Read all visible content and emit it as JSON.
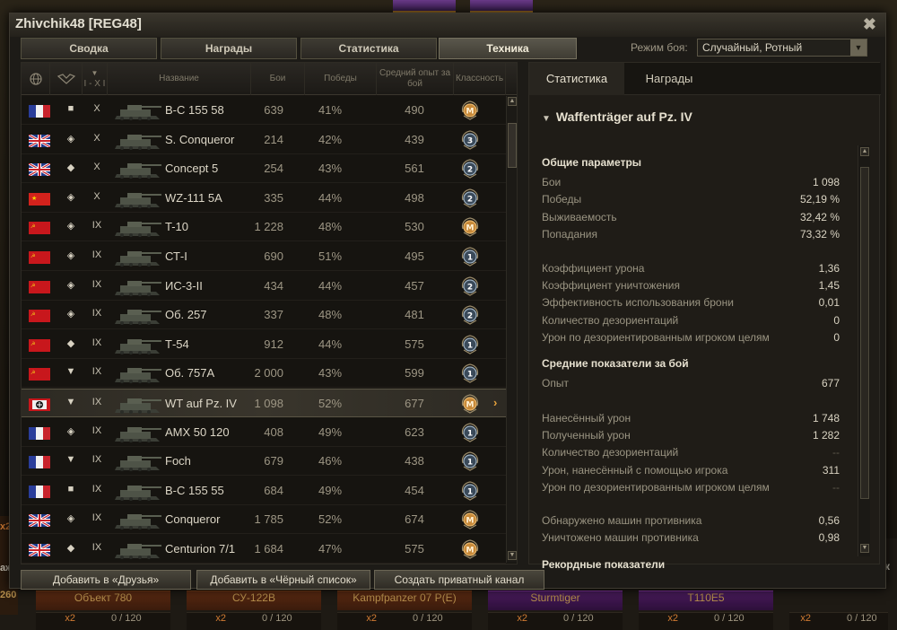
{
  "window": {
    "title": "Zhivchik48 [REG48]",
    "close_glyph": "✖"
  },
  "tabs": [
    {
      "label": "Сводка",
      "active": false
    },
    {
      "label": "Награды",
      "active": false
    },
    {
      "label": "Статистика",
      "active": false
    },
    {
      "label": "Техника",
      "active": true
    }
  ],
  "battle_mode": {
    "label": "Режим боя:",
    "value": "Случайный, Ротный",
    "arrow_glyph": "▼"
  },
  "table": {
    "columns": {
      "nation_icon": "globe-icon",
      "type_icon": "tank-type-icon",
      "tier": "I - X I",
      "name": "Название",
      "battles": "Бои",
      "wins": "Победы",
      "avg_xp": "Средний опыт за бой",
      "mastery": "Классность"
    },
    "rows": [
      {
        "nation": "france",
        "type": "spg",
        "type_glyph": "■",
        "tier": "X",
        "name": "B-C 155 58",
        "battles": "639",
        "wins": "41%",
        "xp": "490",
        "mastery": "M",
        "selected": false
      },
      {
        "nation": "uk",
        "type": "heavy",
        "type_glyph": "◈",
        "tier": "X",
        "name": "S. Conqueror",
        "battles": "214",
        "wins": "42%",
        "xp": "439",
        "mastery": "3",
        "selected": false
      },
      {
        "nation": "uk",
        "type": "medium",
        "type_glyph": "◆",
        "tier": "X",
        "name": "Concept 5",
        "battles": "254",
        "wins": "43%",
        "xp": "561",
        "mastery": "2",
        "selected": false
      },
      {
        "nation": "china",
        "type": "heavy",
        "type_glyph": "◈",
        "tier": "X",
        "name": "WZ-111 5A",
        "battles": "335",
        "wins": "44%",
        "xp": "498",
        "mastery": "2",
        "selected": false
      },
      {
        "nation": "ussr",
        "type": "heavy",
        "type_glyph": "◈",
        "tier": "IX",
        "name": "T-10",
        "battles": "1 228",
        "wins": "48%",
        "xp": "530",
        "mastery": "M",
        "selected": false
      },
      {
        "nation": "ussr",
        "type": "heavy",
        "type_glyph": "◈",
        "tier": "IX",
        "name": "СТ-I",
        "battles": "690",
        "wins": "51%",
        "xp": "495",
        "mastery": "1",
        "selected": false
      },
      {
        "nation": "ussr",
        "type": "heavy",
        "type_glyph": "◈",
        "tier": "IX",
        "name": "ИС-3-II",
        "battles": "434",
        "wins": "44%",
        "xp": "457",
        "mastery": "2",
        "selected": false
      },
      {
        "nation": "ussr",
        "type": "heavy",
        "type_glyph": "◈",
        "tier": "IX",
        "name": "Об. 257",
        "battles": "337",
        "wins": "48%",
        "xp": "481",
        "mastery": "2",
        "selected": false
      },
      {
        "nation": "ussr",
        "type": "medium",
        "type_glyph": "◆",
        "tier": "IX",
        "name": "Т-54",
        "battles": "912",
        "wins": "44%",
        "xp": "575",
        "mastery": "1",
        "selected": false
      },
      {
        "nation": "ussr",
        "type": "td",
        "type_glyph": "▼",
        "tier": "IX",
        "name": "Об. 757А",
        "battles": "2 000",
        "wins": "43%",
        "xp": "599",
        "mastery": "1",
        "selected": false
      },
      {
        "nation": "germany",
        "type": "td",
        "type_glyph": "▼",
        "tier": "IX",
        "name": "WT auf Pz. IV",
        "battles": "1 098",
        "wins": "52%",
        "xp": "677",
        "mastery": "M",
        "selected": true
      },
      {
        "nation": "france",
        "type": "heavy",
        "type_glyph": "◈",
        "tier": "IX",
        "name": "AMX 50 120",
        "battles": "408",
        "wins": "49%",
        "xp": "623",
        "mastery": "1",
        "selected": false
      },
      {
        "nation": "france",
        "type": "td",
        "type_glyph": "▼",
        "tier": "IX",
        "name": "Foch",
        "battles": "679",
        "wins": "46%",
        "xp": "438",
        "mastery": "1",
        "selected": false
      },
      {
        "nation": "france",
        "type": "spg",
        "type_glyph": "■",
        "tier": "IX",
        "name": "B-C 155 55",
        "battles": "684",
        "wins": "49%",
        "xp": "454",
        "mastery": "1",
        "selected": false
      },
      {
        "nation": "uk",
        "type": "heavy",
        "type_glyph": "◈",
        "tier": "IX",
        "name": "Conqueror",
        "battles": "1 785",
        "wins": "52%",
        "xp": "674",
        "mastery": "M",
        "selected": false
      },
      {
        "nation": "uk",
        "type": "medium",
        "type_glyph": "◆",
        "tier": "IX",
        "name": "Centurion 7/1",
        "battles": "1 684",
        "wins": "47%",
        "xp": "575",
        "mastery": "M",
        "selected": false
      }
    ],
    "selected_arrow": "›"
  },
  "right_panel": {
    "tabs": [
      {
        "label": "Статистика",
        "active": true
      },
      {
        "label": "Награды",
        "active": false
      }
    ],
    "vehicle_name": "Waffenträger auf Pz. IV",
    "collapse_glyph": "▼",
    "sections": {
      "general_title": "Общие параметры",
      "general": [
        {
          "label": "Бои",
          "value": "1 098"
        },
        {
          "label": "Победы",
          "value": "52,19 %"
        },
        {
          "label": "Выживаемость",
          "value": "32,42 %"
        },
        {
          "label": "Попадания",
          "value": "73,32 %"
        }
      ],
      "coeffs": [
        {
          "label": "Коэффициент урона",
          "value": "1,36"
        },
        {
          "label": "Коэффициент уничтожения",
          "value": "1,45"
        },
        {
          "label": "Эффективность использования брони",
          "value": "0,01"
        },
        {
          "label": "Количество дезориентаций",
          "value": "0"
        },
        {
          "label": "Урон по дезориентированным игроком целям",
          "value": "0"
        }
      ],
      "avg_title": "Средние показатели за бой",
      "avg_xp": {
        "label": "Опыт",
        "value": "677"
      },
      "avg_damage": [
        {
          "label": "Нанесённый урон",
          "value": "1 748",
          "dim": false
        },
        {
          "label": "Полученный урон",
          "value": "1 282",
          "dim": false
        },
        {
          "label": "Количество дезориентаций",
          "value": "--",
          "dim": true
        },
        {
          "label": "Урон, нанесённый с помощью игрока",
          "value": "311",
          "dim": false
        },
        {
          "label": "Урон по дезориентированным игроком целям",
          "value": "--",
          "dim": true
        }
      ],
      "avg_spot": [
        {
          "label": "Обнаружено машин противника",
          "value": "0,56"
        },
        {
          "label": "Уничтожено машин противника",
          "value": "0,98"
        }
      ],
      "records_title": "Рекордные показатели"
    }
  },
  "buttons": {
    "add_friend": "Добавить в «Друзья»",
    "add_blacklist": "Добавить в «Чёрный список»",
    "private_channel": "Создать приватный канал"
  },
  "background": {
    "carousel": [
      {
        "name": "Объект 780",
        "style": "orange"
      },
      {
        "name": "СУ-122В",
        "style": "orange"
      },
      {
        "name": "Kampfpanzer 07 P(E)",
        "style": "orange"
      },
      {
        "name": "Sturmtiger",
        "style": "purple"
      },
      {
        "name": "T110E5",
        "style": "purple"
      }
    ],
    "progress_label": "0 / 120",
    "multiplier": "x2",
    "left_fragments": [
      "x2",
      "аж",
      "260"
    ],
    "right_fragment": "к"
  },
  "colors": {
    "accent": "#e6a23c",
    "window_bg": "#1d1b17",
    "text_main": "#dcd6c6",
    "text_dim": "#9d9684"
  }
}
